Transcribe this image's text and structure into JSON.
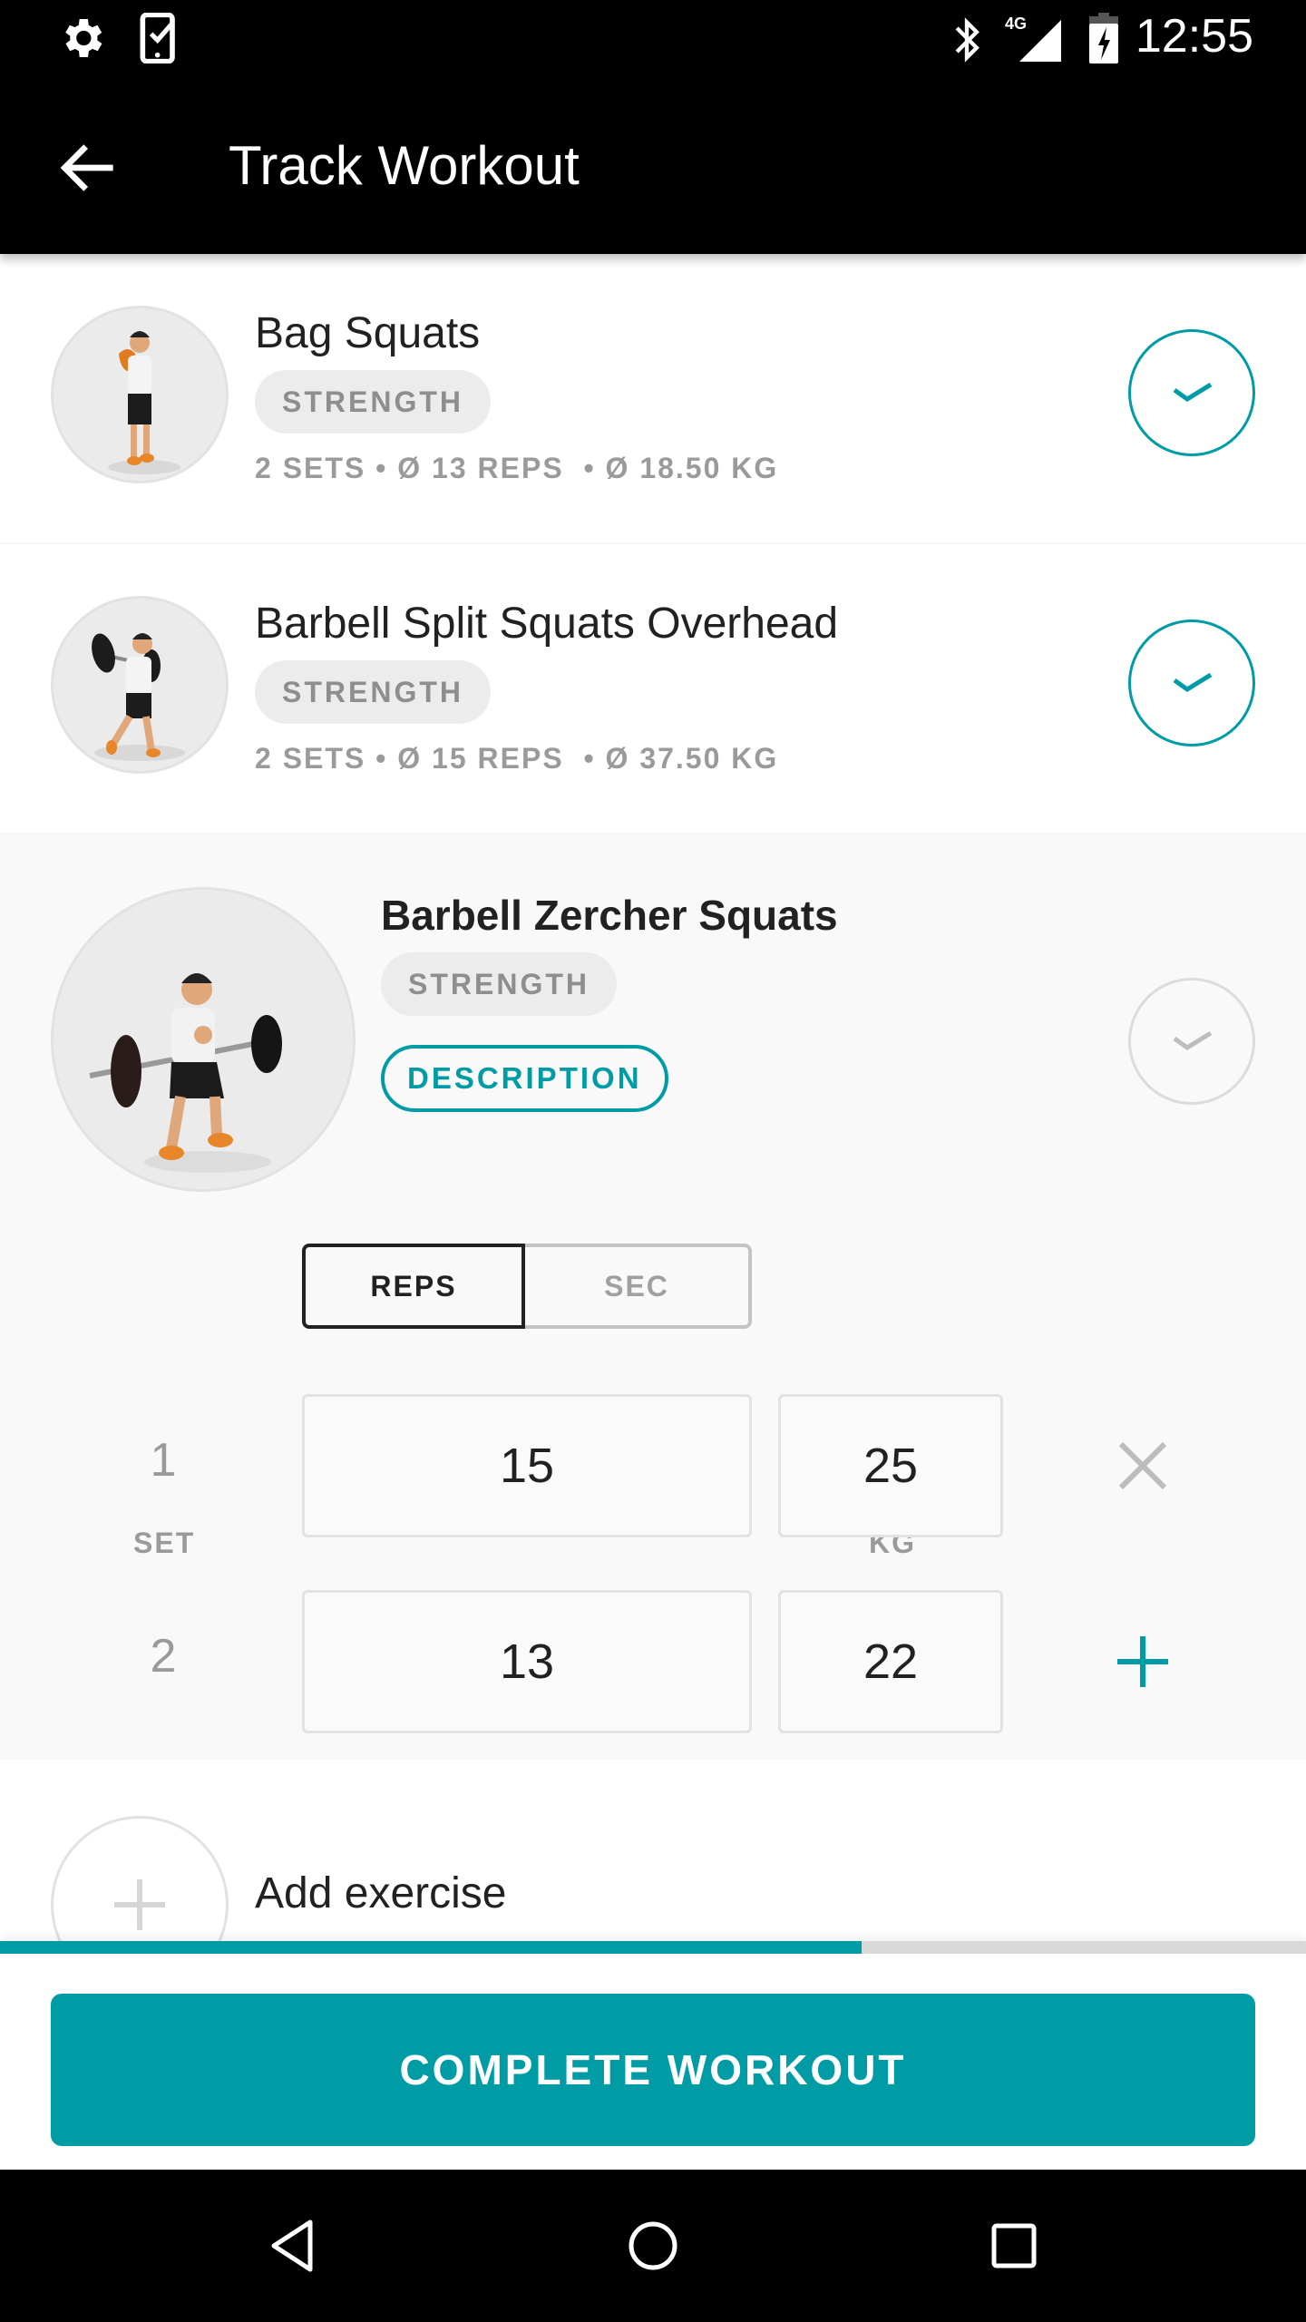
{
  "status_bar": {
    "left_icons": [
      "settings-icon",
      "phone-check-icon"
    ],
    "right_icons": [
      "bluetooth-icon",
      "signal-4g-icon",
      "battery-charging-icon"
    ],
    "network": "4G",
    "time": "12:55"
  },
  "app_bar": {
    "back_icon": "arrow-left-icon",
    "title": "Track Workout"
  },
  "exercises": [
    {
      "name": "Bag Squats",
      "category": "STRENGTH",
      "stats": "2 SETS • Ø 13 REPS  • Ø 18.50 KG",
      "completed": true
    },
    {
      "name": "Barbell Split Squats Overhead",
      "category": "STRENGTH",
      "stats": "2 SETS • Ø 15 REPS  • Ø 37.50 KG",
      "completed": true
    }
  ],
  "active_exercise": {
    "name": "Barbell Zercher Squats",
    "category": "STRENGTH",
    "description_label": "DESCRIPTION",
    "completed": false,
    "columns": {
      "set": "SET",
      "reps": "REPS",
      "sec": "SEC",
      "kg": "KG"
    },
    "selected_mode": "REPS",
    "sets": [
      {
        "set": "1",
        "reps": "15",
        "kg": "25",
        "action": "remove"
      },
      {
        "set": "2",
        "reps": "13",
        "kg": "22",
        "action": "add"
      }
    ]
  },
  "add_exercise": {
    "label": "Add exercise"
  },
  "progress": {
    "fraction": 0.66
  },
  "footer": {
    "complete_label": "COMPLETE WORKOUT"
  },
  "nav_bar": {
    "icons": [
      "nav-back-icon",
      "nav-home-icon",
      "nav-recents-icon"
    ]
  },
  "colors": {
    "accent": "#009ca6",
    "chip_bg": "#ececec",
    "muted_text": "#9a9a9a",
    "inactive_check": "#dcdcdc"
  }
}
